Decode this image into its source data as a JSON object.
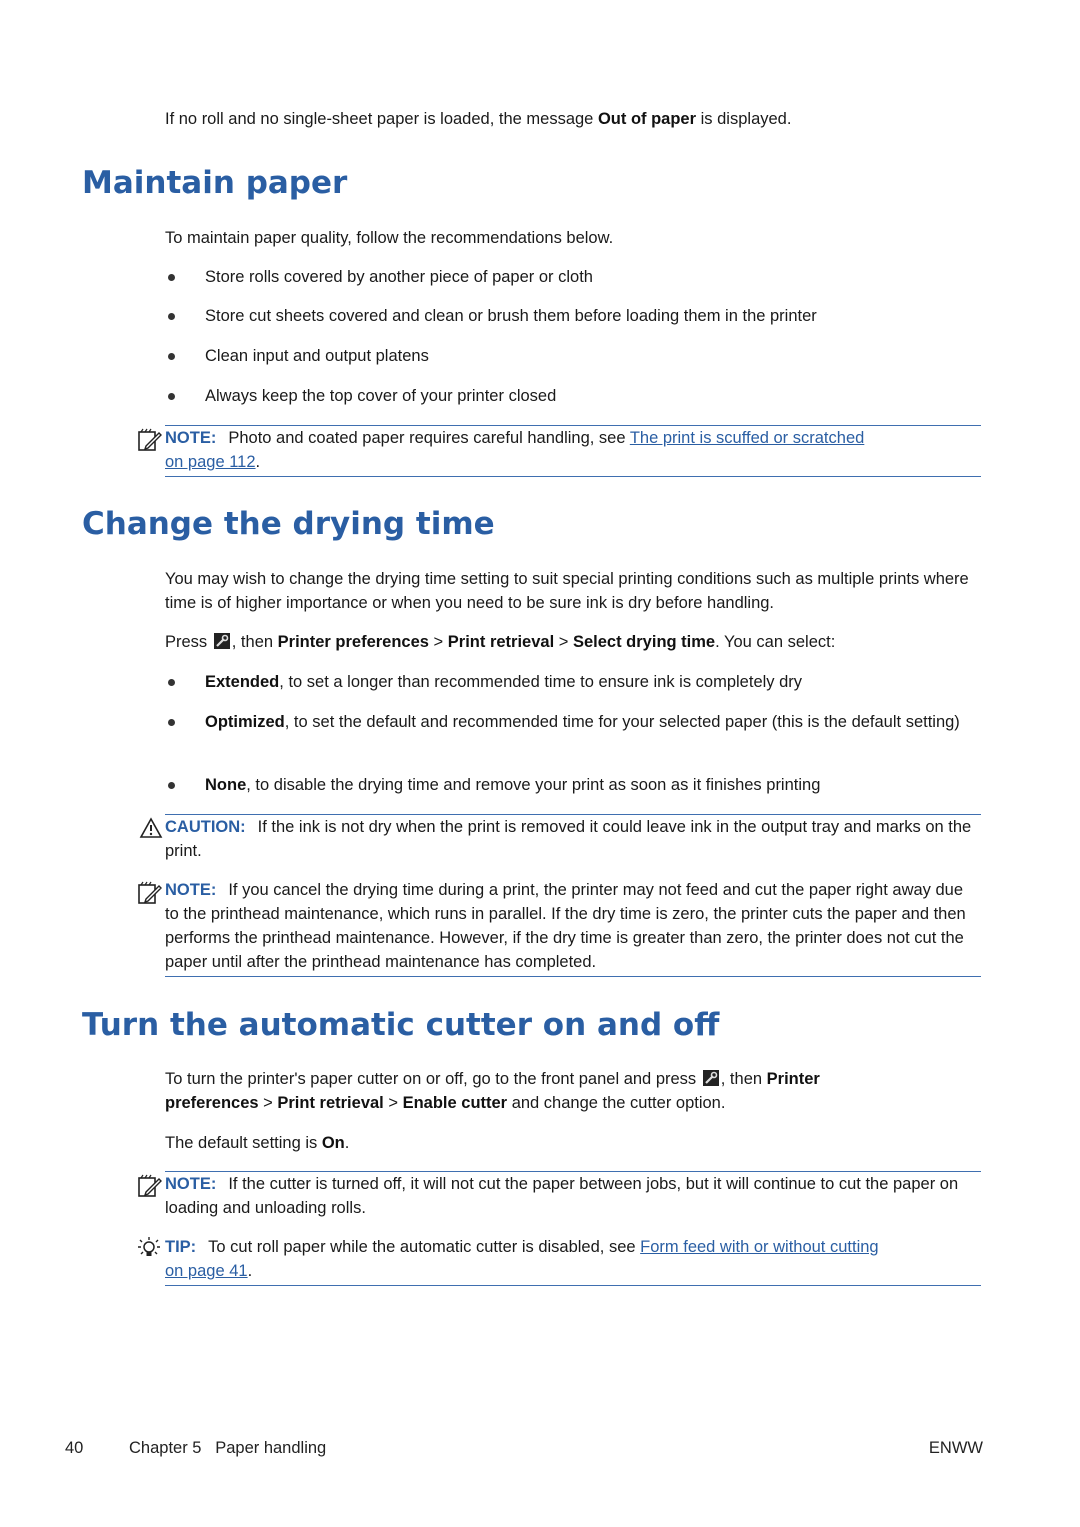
{
  "intro": {
    "pre": "If no roll and no single-sheet paper is loaded, the message ",
    "bold": "Out of paper",
    "post": " is displayed."
  },
  "sections": {
    "maintain": {
      "title": "Maintain paper",
      "intro": "To maintain paper quality, follow the recommendations below.",
      "bullets": [
        "Store rolls covered by another piece of paper or cloth",
        "Store cut sheets covered and clean or brush them before loading them in the printer",
        "Clean input and output platens",
        "Always keep the top cover of your printer closed"
      ],
      "note": {
        "label": "NOTE:",
        "text": "Photo and coated paper requires careful handling, see ",
        "link1": "The print is scuffed or scratched",
        "link2": "on page 112",
        "end": "."
      }
    },
    "drying": {
      "title": "Change the drying time",
      "para": "You may wish to change the drying time setting to suit special printing conditions such as multiple prints where time is of higher importance or when you need to be sure ink is dry before handling.",
      "press_pre": "Press ",
      "press_mid": ", then ",
      "path1": "Printer preferences",
      "sep": " > ",
      "path2": "Print retrieval",
      "path3": "Select drying time",
      "press_post": ". You can select:",
      "options": [
        {
          "bold": "Extended",
          "text": ", to set a longer than recommended time to ensure ink is completely dry"
        },
        {
          "bold": "Optimized",
          "text": ", to set the default and recommended time for your selected paper (this is the default setting)"
        },
        {
          "bold": "None",
          "text": ", to disable the drying time and remove your print as soon as it finishes printing"
        }
      ],
      "caution": {
        "label": "CAUTION:",
        "text": "If the ink is not dry when the print is removed it could leave ink in the output tray and marks on the print."
      },
      "note": {
        "label": "NOTE:",
        "text": "If you cancel the drying time during a print, the printer may not feed and cut the paper right away due to the printhead maintenance, which runs in parallel. If the dry time is zero, the printer cuts the paper and then performs the printhead maintenance. However, if the dry time is greater than zero, the printer does not cut the paper until after the printhead maintenance has completed."
      }
    },
    "cutter": {
      "title": "Turn the automatic cutter on and off",
      "para_pre": "To turn the printer's paper cutter on or off, go to the front panel and press ",
      "para_mid": ", then ",
      "path1": "Printer preferences",
      "sep": " > ",
      "path2": "Print retrieval",
      "path3": "Enable cutter",
      "para_post": " and change the cutter option.",
      "default_pre": "The default setting is ",
      "default_val": "On",
      "default_post": ".",
      "note": {
        "label": "NOTE:",
        "text": "If the cutter is turned off, it will not cut the paper between jobs, but it will continue to cut the paper on loading and unloading rolls."
      },
      "tip": {
        "label": "TIP:",
        "text": "To cut roll paper while the automatic cutter is disabled, see ",
        "link1": "Form feed with or without cutting",
        "link2": "on page 41",
        "end": "."
      }
    }
  },
  "footer": {
    "page_number": "40",
    "chapter": "Chapter 5   Paper handling",
    "locale": "ENWW"
  }
}
